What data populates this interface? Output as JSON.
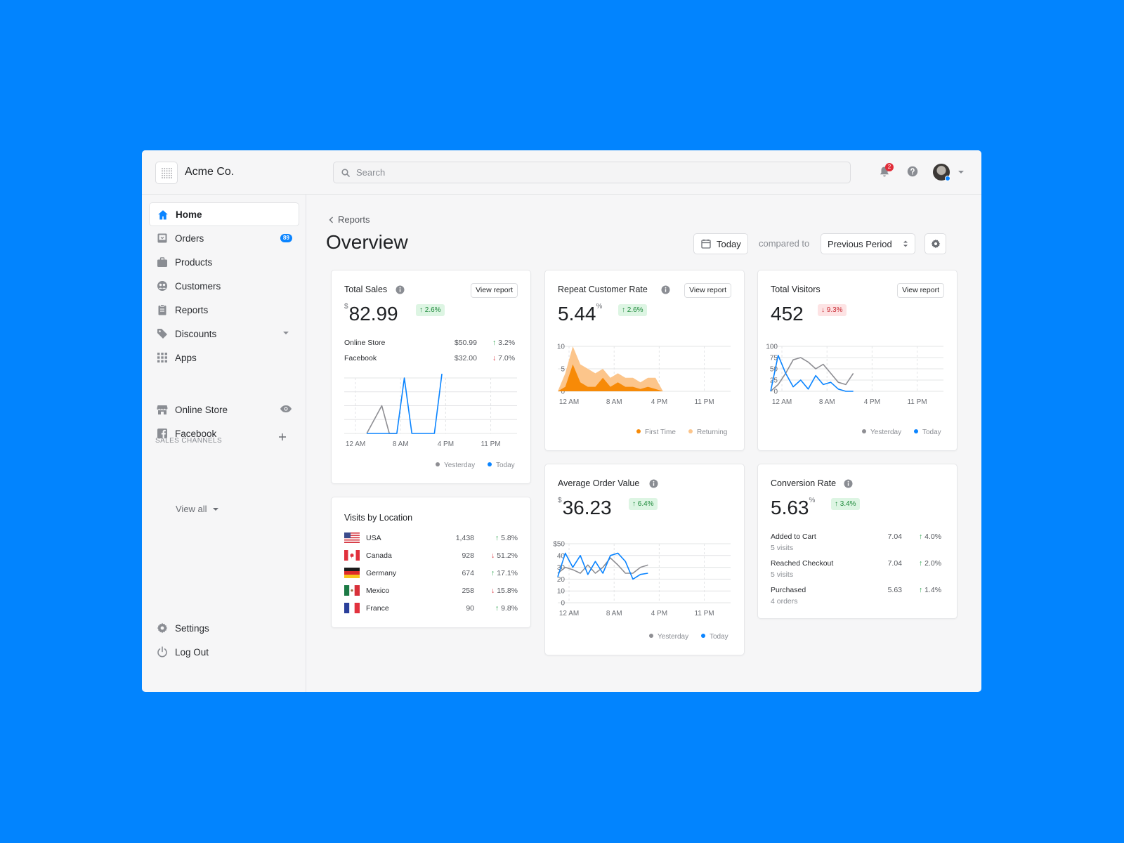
{
  "app": {
    "brand": "Acme Co.",
    "search_placeholder": "Search",
    "notification_count": "2"
  },
  "sidebar": {
    "items": [
      {
        "label": "Home",
        "icon": "home-icon",
        "active": true
      },
      {
        "label": "Orders",
        "icon": "orders-icon",
        "badge": "89"
      },
      {
        "label": "Products",
        "icon": "products-icon"
      },
      {
        "label": "Customers",
        "icon": "customers-icon"
      },
      {
        "label": "Reports",
        "icon": "reports-icon"
      },
      {
        "label": "Discounts",
        "icon": "tag-icon"
      },
      {
        "label": "Apps",
        "icon": "apps-grid-icon"
      }
    ],
    "section_title": "SALES CHANNELS",
    "channels": [
      {
        "label": "Online Store",
        "icon": "store-icon"
      },
      {
        "label": "Facebook",
        "icon": "facebook-icon"
      }
    ],
    "view_all": "View all",
    "settings": "Settings",
    "logout": "Log Out"
  },
  "header": {
    "breadcrumb": "Reports",
    "title": "Overview",
    "date_button": "Today",
    "compared_to": "compared to",
    "period_select": "Previous Period"
  },
  "colors": {
    "accent": "#0a84ff",
    "yesterday": "#8e8e93",
    "first_time": "#f78a07",
    "returning": "#fcc58b",
    "up": "#1f9d43",
    "down": "#d92d38"
  },
  "cards": {
    "total_sales": {
      "title": "Total Sales",
      "view_report": "View report",
      "currency": "$",
      "value": "82.99",
      "delta": "↑ 2.6%",
      "rows": [
        {
          "label": "Online Store",
          "value": "$50.99",
          "arrow": "↑",
          "delta": "3.2%"
        },
        {
          "label": "Facebook",
          "value": "$32.00",
          "arrow": "↓",
          "delta": "7.0%"
        }
      ],
      "legend": [
        "Yesterday",
        "Today"
      ]
    },
    "repeat_rate": {
      "title": "Repeat Customer Rate",
      "view_report": "View report",
      "value": "5.44",
      "unit": "%",
      "delta": "↑ 2.6%",
      "legend": [
        "First Time",
        "Returning"
      ]
    },
    "total_visitors": {
      "title": "Total Visitors",
      "view_report": "View report",
      "value": "452",
      "delta": "↓ 9.3%",
      "legend": [
        "Yesterday",
        "Today"
      ]
    },
    "avg_order": {
      "title": "Average Order Value",
      "currency": "$",
      "value": "36.23",
      "delta": "↑ 6.4%",
      "legend": [
        "Yesterday",
        "Today"
      ]
    },
    "conversion": {
      "title": "Conversion Rate",
      "value": "5.63",
      "unit": "%",
      "delta": "↑ 3.4%",
      "rows": [
        {
          "label": "Added to Cart",
          "sub": "5 visits",
          "value": "7.04",
          "arrow": "↑",
          "delta": "4.0%"
        },
        {
          "label": "Reached Checkout",
          "sub": "5 visits",
          "value": "7.04",
          "arrow": "↑",
          "delta": "2.0%"
        },
        {
          "label": "Purchased",
          "sub": "4 orders",
          "value": "5.63",
          "arrow": "↑",
          "delta": "1.4%"
        }
      ]
    },
    "visits_by_location": {
      "title": "Visits by Location",
      "rows": [
        {
          "country": "USA",
          "count": "1,438",
          "arrow": "↑",
          "delta": "5.8%"
        },
        {
          "country": "Canada",
          "count": "928",
          "arrow": "↓",
          "delta": "51.2%"
        },
        {
          "country": "Germany",
          "count": "674",
          "arrow": "↑",
          "delta": "17.1%"
        },
        {
          "country": "Mexico",
          "count": "258",
          "arrow": "↓",
          "delta": "15.8%"
        },
        {
          "country": "France",
          "count": "90",
          "arrow": "↑",
          "delta": "9.8%"
        }
      ]
    }
  },
  "chart_data": [
    {
      "id": "total_sales",
      "type": "line",
      "x_ticks": [
        "12 AM",
        "8 AM",
        "4 PM",
        "11 PM"
      ],
      "x_range": [
        0,
        23
      ],
      "ylim": [
        0,
        80
      ],
      "series": [
        {
          "name": "Yesterday",
          "x": [
            3,
            5,
            6,
            7
          ],
          "values": [
            0,
            40,
            0,
            0
          ]
        },
        {
          "name": "Today",
          "x": [
            3,
            7,
            8,
            9,
            12,
            13
          ],
          "values": [
            0,
            0,
            80,
            0,
            0,
            86
          ]
        }
      ]
    },
    {
      "id": "repeat_rate",
      "type": "area",
      "x_ticks": [
        "12 AM",
        "8 AM",
        "4 PM",
        "11 PM"
      ],
      "x_range": [
        0,
        23
      ],
      "y_ticks": [
        "0",
        "5",
        "10"
      ],
      "ylim": [
        0,
        10
      ],
      "series": [
        {
          "name": "Returning",
          "x": [
            0,
            1,
            2,
            3,
            4,
            5,
            6,
            7,
            8,
            9,
            10,
            11,
            12,
            13,
            14
          ],
          "values": [
            0,
            4,
            10,
            6,
            5,
            4,
            5,
            3,
            4,
            3,
            3,
            2,
            3,
            3,
            0
          ]
        },
        {
          "name": "First Time",
          "x": [
            0,
            1,
            2,
            3,
            4,
            5,
            6,
            7,
            8,
            9,
            10,
            11,
            12,
            13,
            14
          ],
          "values": [
            0,
            1,
            6,
            2,
            1,
            1,
            3,
            1,
            2,
            1,
            1,
            0.5,
            1,
            0.5,
            0
          ]
        }
      ]
    },
    {
      "id": "total_visitors",
      "type": "line",
      "x_ticks": [
        "12 AM",
        "8 AM",
        "4 PM",
        "11 PM"
      ],
      "x_range": [
        0,
        23
      ],
      "y_ticks": [
        "0",
        "25",
        "50",
        "75",
        "100"
      ],
      "ylim": [
        0,
        100
      ],
      "series": [
        {
          "name": "Yesterday",
          "x": [
            0,
            1,
            2,
            3,
            4,
            5,
            6,
            7,
            8,
            9,
            10,
            11
          ],
          "values": [
            0,
            15,
            40,
            70,
            75,
            65,
            50,
            60,
            40,
            20,
            15,
            40
          ]
        },
        {
          "name": "Today",
          "x": [
            0,
            1,
            2,
            3,
            4,
            5,
            6,
            7,
            8,
            9,
            10,
            11
          ],
          "values": [
            0,
            80,
            40,
            10,
            25,
            5,
            35,
            15,
            20,
            5,
            0,
            0
          ]
        }
      ]
    },
    {
      "id": "avg_order",
      "type": "line",
      "x_ticks": [
        "12 AM",
        "8 AM",
        "4 PM",
        "11 PM"
      ],
      "x_range": [
        0,
        23
      ],
      "y_ticks": [
        "0",
        "10",
        "20",
        "30",
        "40",
        "$50"
      ],
      "ylim": [
        0,
        50
      ],
      "series": [
        {
          "name": "Yesterday",
          "x": [
            0,
            1,
            2,
            3,
            4,
            5,
            6,
            7,
            8,
            9,
            10,
            11,
            12
          ],
          "values": [
            25,
            30,
            28,
            25,
            32,
            25,
            30,
            38,
            32,
            25,
            25,
            30,
            32
          ]
        },
        {
          "name": "Today",
          "x": [
            0,
            1,
            2,
            3,
            4,
            5,
            6,
            7,
            8,
            9,
            10,
            11,
            12
          ],
          "values": [
            22,
            42,
            30,
            40,
            24,
            35,
            25,
            40,
            42,
            35,
            20,
            24,
            25
          ]
        }
      ]
    }
  ]
}
